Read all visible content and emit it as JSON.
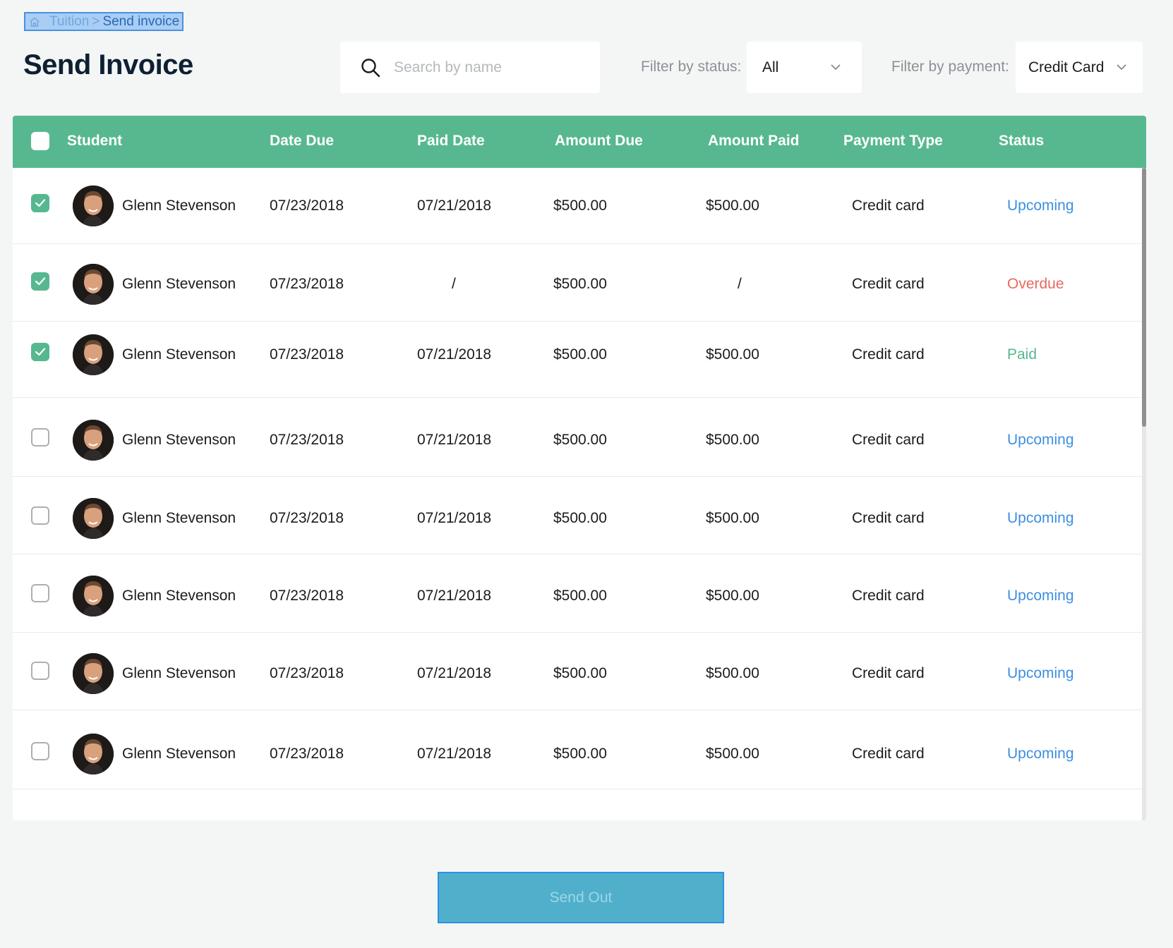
{
  "breadcrumb": {
    "icon": "home-icon",
    "parent": "Tuition",
    "separator": ">",
    "current": "Send invoice"
  },
  "page_title": "Send Invoice",
  "search": {
    "icon": "search-icon",
    "placeholder": "Search by name",
    "value": ""
  },
  "filters": {
    "status": {
      "label": "Filter by status:",
      "value": "All"
    },
    "payment": {
      "label": "Filter by payment:",
      "value": "Credit Card"
    }
  },
  "table": {
    "columns": [
      "Student",
      "Date Due",
      "Paid Date",
      "Amount Due",
      "Amount Paid",
      "Payment Type",
      "Status"
    ],
    "header_checked": false,
    "rows": [
      {
        "checked": true,
        "student": "Glenn Stevenson",
        "date_due": "07/23/2018",
        "paid_date": "07/21/2018",
        "amount_due": "$500.00",
        "amount_paid": "$500.00",
        "payment_type": "Credit card",
        "status": "Upcoming",
        "status_kind": "upcoming"
      },
      {
        "checked": true,
        "student": "Glenn Stevenson",
        "date_due": "07/23/2018",
        "paid_date": "/",
        "amount_due": "$500.00",
        "amount_paid": "/",
        "payment_type": "Credit card",
        "status": "Overdue",
        "status_kind": "overdue"
      },
      {
        "checked": true,
        "student": "Glenn Stevenson",
        "date_due": "07/23/2018",
        "paid_date": "07/21/2018",
        "amount_due": "$500.00",
        "amount_paid": "$500.00",
        "payment_type": "Credit card",
        "status": "Paid",
        "status_kind": "paid"
      },
      {
        "checked": false,
        "student": "Glenn Stevenson",
        "date_due": "07/23/2018",
        "paid_date": "07/21/2018",
        "amount_due": "$500.00",
        "amount_paid": "$500.00",
        "payment_type": "Credit card",
        "status": "Upcoming",
        "status_kind": "upcoming"
      },
      {
        "checked": false,
        "student": "Glenn Stevenson",
        "date_due": "07/23/2018",
        "paid_date": "07/21/2018",
        "amount_due": "$500.00",
        "amount_paid": "$500.00",
        "payment_type": "Credit card",
        "status": "Upcoming",
        "status_kind": "upcoming"
      },
      {
        "checked": false,
        "student": "Glenn Stevenson",
        "date_due": "07/23/2018",
        "paid_date": "07/21/2018",
        "amount_due": "$500.00",
        "amount_paid": "$500.00",
        "payment_type": "Credit card",
        "status": "Upcoming",
        "status_kind": "upcoming"
      },
      {
        "checked": false,
        "student": "Glenn Stevenson",
        "date_due": "07/23/2018",
        "paid_date": "07/21/2018",
        "amount_due": "$500.00",
        "amount_paid": "$500.00",
        "payment_type": "Credit card",
        "status": "Upcoming",
        "status_kind": "upcoming"
      },
      {
        "checked": false,
        "student": "Glenn Stevenson",
        "date_due": "07/23/2018",
        "paid_date": "07/21/2018",
        "amount_due": "$500.00",
        "amount_paid": "$500.00",
        "payment_type": "Credit card",
        "status": "Upcoming",
        "status_kind": "upcoming"
      }
    ]
  },
  "send_button": {
    "label": "Send Out"
  },
  "colors": {
    "accent_green": "#57b890",
    "upcoming": "#3d8fe0",
    "overdue": "#e8695e",
    "paid": "#57b890",
    "send_button": "#50b0cc"
  }
}
